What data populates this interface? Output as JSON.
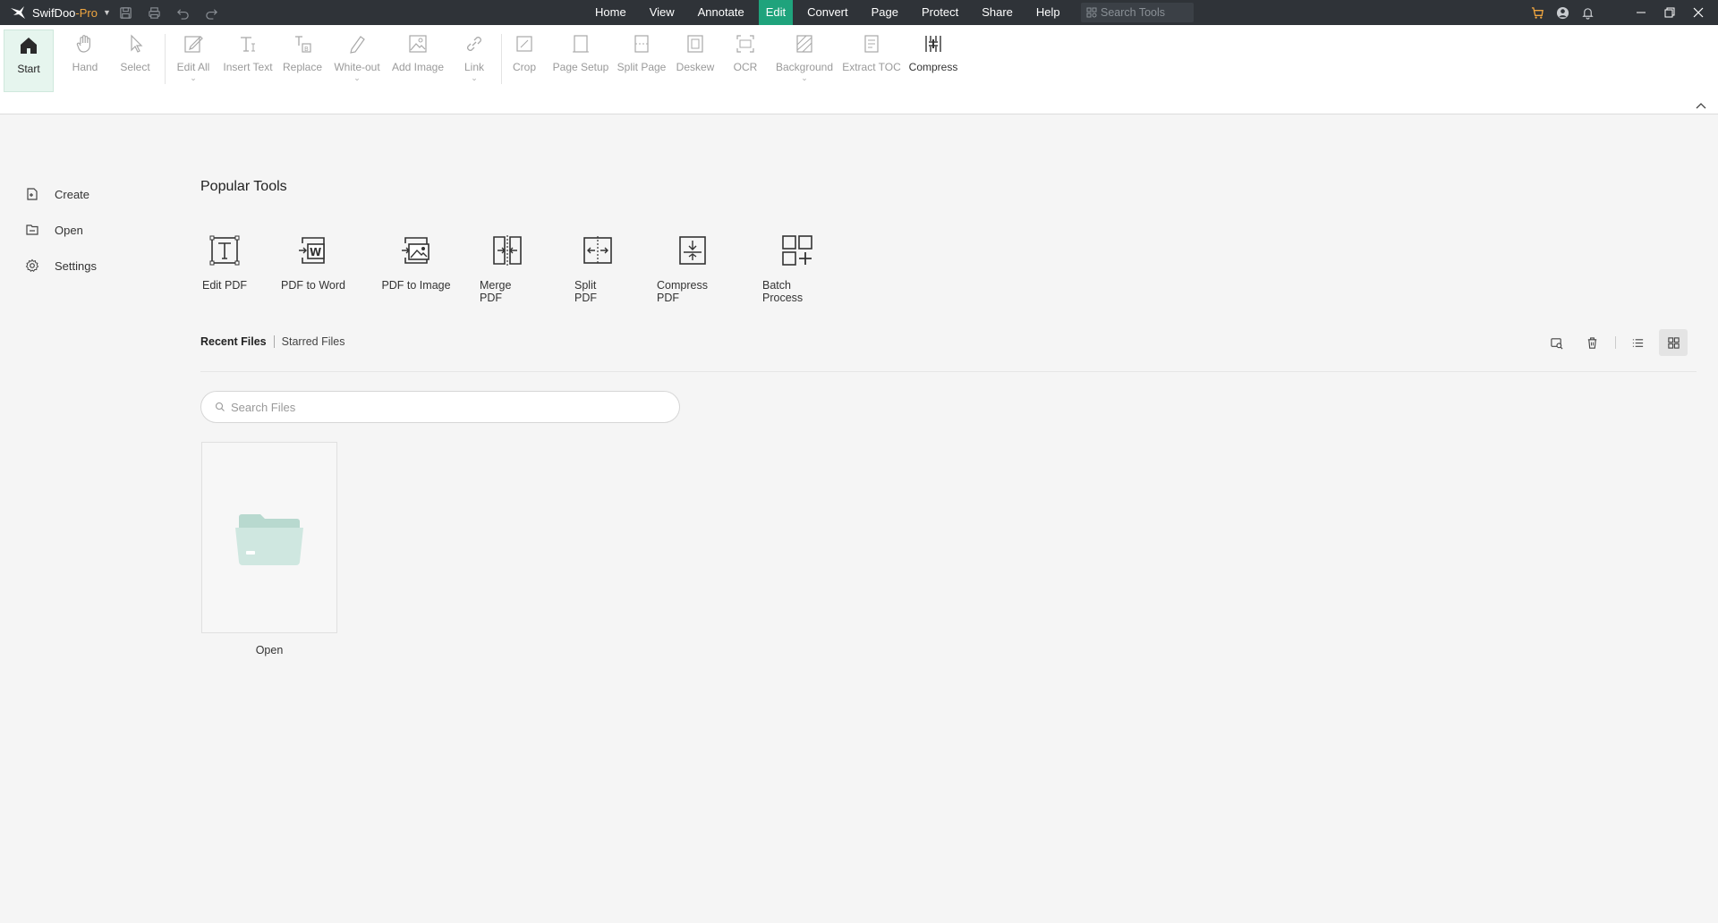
{
  "app": {
    "name": "SwifDoo",
    "edition": "-Pro",
    "logo_icon": "swift-bird-icon"
  },
  "colors": {
    "titlebar": "#2f3338",
    "accent": "#1fa37c",
    "pro": "#f0a640",
    "folder": "#cfe7e0"
  },
  "menus": [
    {
      "label": "Home"
    },
    {
      "label": "View"
    },
    {
      "label": "Annotate"
    },
    {
      "label": "Edit",
      "active": true
    },
    {
      "label": "Convert"
    },
    {
      "label": "Page"
    },
    {
      "label": "Protect"
    },
    {
      "label": "Share"
    },
    {
      "label": "Help"
    }
  ],
  "search_tools": {
    "placeholder": "Search Tools"
  },
  "ribbon": {
    "tools": [
      {
        "label": "Start",
        "icon": "home-icon",
        "enabled": true,
        "selected": true
      },
      {
        "label": "Hand",
        "icon": "hand-icon",
        "enabled": false
      },
      {
        "label": "Select",
        "icon": "cursor-icon",
        "enabled": false
      },
      {
        "label": "Edit All",
        "icon": "edit-all-icon",
        "enabled": false,
        "dropdown": true
      },
      {
        "label": "Insert Text",
        "icon": "insert-text-icon",
        "enabled": false
      },
      {
        "label": "Replace",
        "icon": "replace-icon",
        "enabled": false
      },
      {
        "label": "White-out",
        "icon": "white-out-icon",
        "enabled": false,
        "dropdown": true
      },
      {
        "label": "Add Image",
        "icon": "add-image-icon",
        "enabled": false
      },
      {
        "label": "Link",
        "icon": "link-icon",
        "enabled": false,
        "dropdown": true
      },
      {
        "label": "Crop",
        "icon": "crop-icon",
        "enabled": false
      },
      {
        "label": "Page Setup",
        "icon": "page-setup-icon",
        "enabled": false
      },
      {
        "label": "Split Page",
        "icon": "split-page-icon",
        "enabled": false
      },
      {
        "label": "Deskew",
        "icon": "deskew-icon",
        "enabled": false
      },
      {
        "label": "OCR",
        "icon": "ocr-icon",
        "enabled": false
      },
      {
        "label": "Background",
        "icon": "background-icon",
        "enabled": false,
        "dropdown": true
      },
      {
        "label": "Extract TOC",
        "icon": "extract-toc-icon",
        "enabled": false
      },
      {
        "label": "Compress",
        "icon": "compress-icon",
        "enabled": true
      }
    ]
  },
  "leftnav": [
    {
      "label": "Create",
      "icon": "create-icon"
    },
    {
      "label": "Open",
      "icon": "open-icon"
    },
    {
      "label": "Settings",
      "icon": "settings-gear-icon"
    }
  ],
  "popular": {
    "title": "Popular Tools",
    "tools": [
      {
        "label": "Edit PDF",
        "icon": "edit-pdf-icon"
      },
      {
        "label": "PDF to Word",
        "icon": "pdf-to-word-icon"
      },
      {
        "label": "PDF to Image",
        "icon": "pdf-to-image-icon"
      },
      {
        "label": "Merge PDF",
        "icon": "merge-pdf-icon"
      },
      {
        "label": "Split PDF",
        "icon": "split-pdf-icon"
      },
      {
        "label": "Compress PDF",
        "icon": "compress-pdf-icon"
      },
      {
        "label": "Batch Process",
        "icon": "batch-process-icon"
      }
    ]
  },
  "files": {
    "tabs": [
      {
        "label": "Recent Files",
        "active": true
      },
      {
        "label": "Starred Files"
      }
    ],
    "search_placeholder": "Search Files",
    "open_card_label": "Open"
  }
}
